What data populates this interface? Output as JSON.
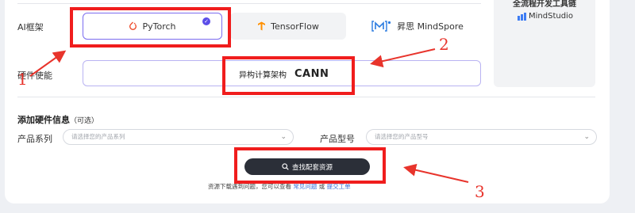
{
  "toolchain": {
    "title": "全流程开发工具链",
    "mindstudio": "MindStudio"
  },
  "ai_framework": {
    "label": "AI框架",
    "options": [
      {
        "name": "PyTorch",
        "selected": true
      },
      {
        "name": "TensorFlow",
        "selected": false
      },
      {
        "name": "昇思 MindSpore",
        "selected": false
      }
    ]
  },
  "hardware": {
    "label": "硬件使能",
    "architecture_label": "异构计算架构",
    "architecture_logo": "CANN"
  },
  "add_hw_info": {
    "title": "添加硬件信息",
    "optional": "（可选）"
  },
  "product_series": {
    "label": "产品系列",
    "placeholder": "请选择您的产品系列"
  },
  "product_model": {
    "label": "产品型号",
    "placeholder": "请选择您的产品型号"
  },
  "search_button": "查找配套资源",
  "help": {
    "prefix": "资源下载遇到问题，您可以查看",
    "faq_link": "常见问题",
    "or": "或",
    "ticket_link": "提交工单"
  },
  "annotations": [
    "1",
    "2",
    "3"
  ],
  "colors": {
    "accent": "#5b4de8",
    "annotation_red": "#f01d1d",
    "button_dark": "#2b2f38",
    "link": "#3a6fd8"
  }
}
